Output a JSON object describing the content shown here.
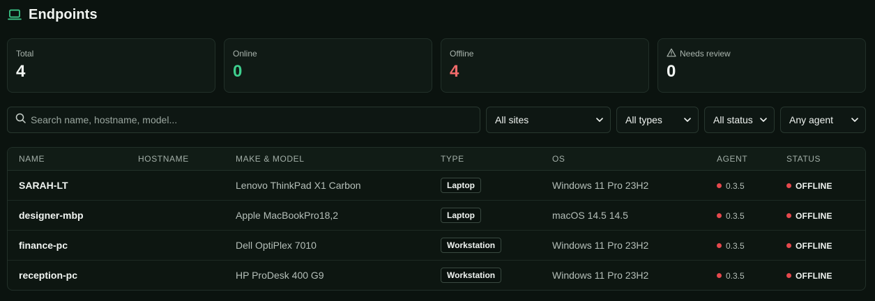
{
  "header": {
    "title": "Endpoints",
    "icon": "laptop-icon",
    "accent": "#3ecf8e"
  },
  "stats": [
    {
      "label": "Total",
      "value": "4",
      "color": "#f1f5f2"
    },
    {
      "label": "Online",
      "value": "0",
      "color": "#3ecf8e"
    },
    {
      "label": "Offline",
      "value": "4",
      "color": "#f26b6b"
    },
    {
      "label": "Needs review",
      "value": "0",
      "color": "#f1f5f2",
      "icon": "warning-icon"
    }
  ],
  "filters": {
    "search_placeholder": "Search name, hostname, model...",
    "site": "All sites",
    "type": "All types",
    "status": "All status",
    "agent": "Any agent"
  },
  "table": {
    "columns": [
      "NAME",
      "HOSTNAME",
      "MAKE & MODEL",
      "TYPE",
      "OS",
      "AGENT",
      "STATUS"
    ],
    "rows": [
      {
        "name": "SARAH-LT",
        "hostname": "",
        "model": "Lenovo ThinkPad X1 Carbon",
        "type": "Laptop",
        "os": "Windows 11 Pro 23H2",
        "agent": "0.3.5",
        "status": "OFFLINE"
      },
      {
        "name": "designer-mbp",
        "hostname": "",
        "model": "Apple MacBookPro18,2",
        "type": "Laptop",
        "os": "macOS 14.5 14.5",
        "agent": "0.3.5",
        "status": "OFFLINE"
      },
      {
        "name": "finance-pc",
        "hostname": "",
        "model": "Dell OptiPlex 7010",
        "type": "Workstation",
        "os": "Windows 11 Pro 23H2",
        "agent": "0.3.5",
        "status": "OFFLINE"
      },
      {
        "name": "reception-pc",
        "hostname": "",
        "model": "HP ProDesk 400 G9",
        "type": "Workstation",
        "os": "Windows 11 Pro 23H2",
        "agent": "0.3.5",
        "status": "OFFLINE"
      }
    ]
  },
  "colors": {
    "status_offline": "#e5484d",
    "background": "#0b130f"
  }
}
